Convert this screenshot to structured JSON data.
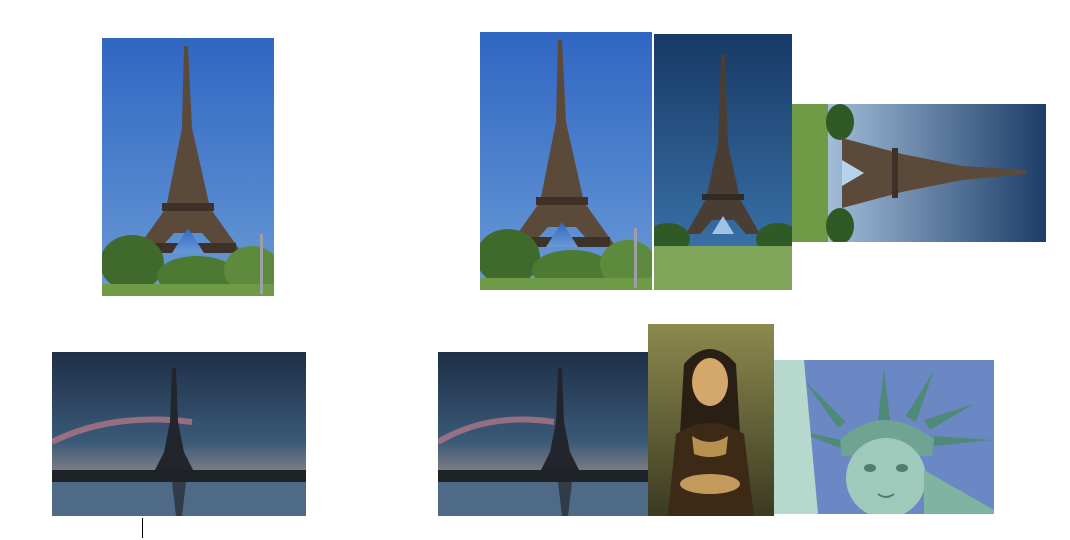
{
  "query_images": [
    {
      "id": "q1",
      "subject": "eiffel-tower-day-portrait"
    },
    {
      "id": "q2",
      "subject": "eiffel-tower-dusk-landscape"
    }
  ],
  "result_rows": [
    {
      "row": 1,
      "images": [
        "eiffel-tower-day-portrait",
        "eiffel-tower-champ-de-mars",
        "eiffel-tower-rotated"
      ]
    },
    {
      "row": 2,
      "images": [
        "eiffel-tower-dusk-landscape",
        "mona-lisa",
        "statue-of-liberty"
      ]
    }
  ],
  "colors": {
    "sky_day": "#3b73c6",
    "sky_dusk": "#2c3f57",
    "lawn": "#6f9b46",
    "liberty_sky": "#6b88c4"
  }
}
